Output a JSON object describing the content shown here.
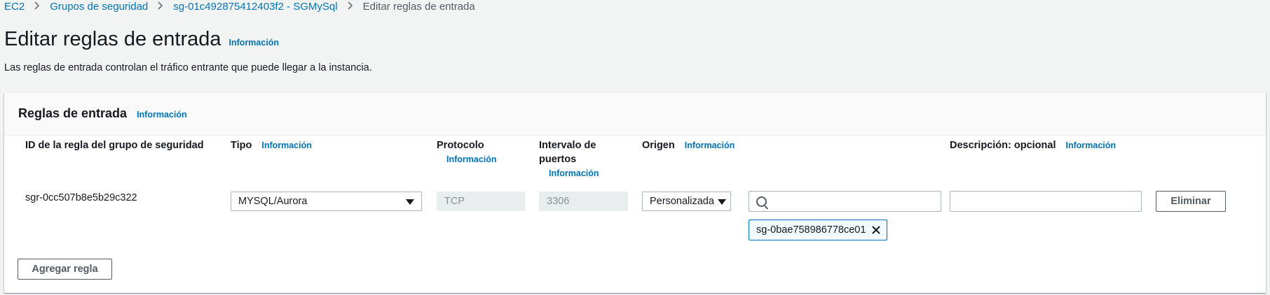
{
  "breadcrumb": {
    "items": [
      "EC2",
      "Grupos de seguridad",
      "sg-01c492875412403f2 - SGMySql"
    ],
    "current": "Editar reglas de entrada"
  },
  "page": {
    "title": "Editar reglas de entrada",
    "info": "Información",
    "description": "Las reglas de entrada controlan el tráfico entrante que puede llegar a la instancia."
  },
  "panel": {
    "title": "Reglas de entrada",
    "info": "Información",
    "columns": {
      "rule_id": "ID de la regla del grupo de seguridad",
      "type": "Tipo",
      "protocol": "Protocolo",
      "port_range_line1": "Intervalo de",
      "port_range_line2": "puertos",
      "source": "Origen",
      "description": "Descripción: opcional",
      "info": "Información"
    },
    "rule": {
      "id": "sgr-0cc507b8e5b29c322",
      "type": "MYSQL/Aurora",
      "protocol": "TCP",
      "port": "3306",
      "source": "Personalizada",
      "search_value": "",
      "description_value": "",
      "token": "sg-0bae758986778ce01",
      "delete_label": "Eliminar"
    },
    "add_rule_label": "Agregar regla"
  },
  "icons": {
    "breadcrumb_separator": "chevron-right-icon",
    "dropdown": "caret-down-icon",
    "search": "search-icon",
    "token_remove": "close-icon"
  },
  "colors": {
    "link": "#0073bb",
    "page_background": "#f2f3f3"
  }
}
